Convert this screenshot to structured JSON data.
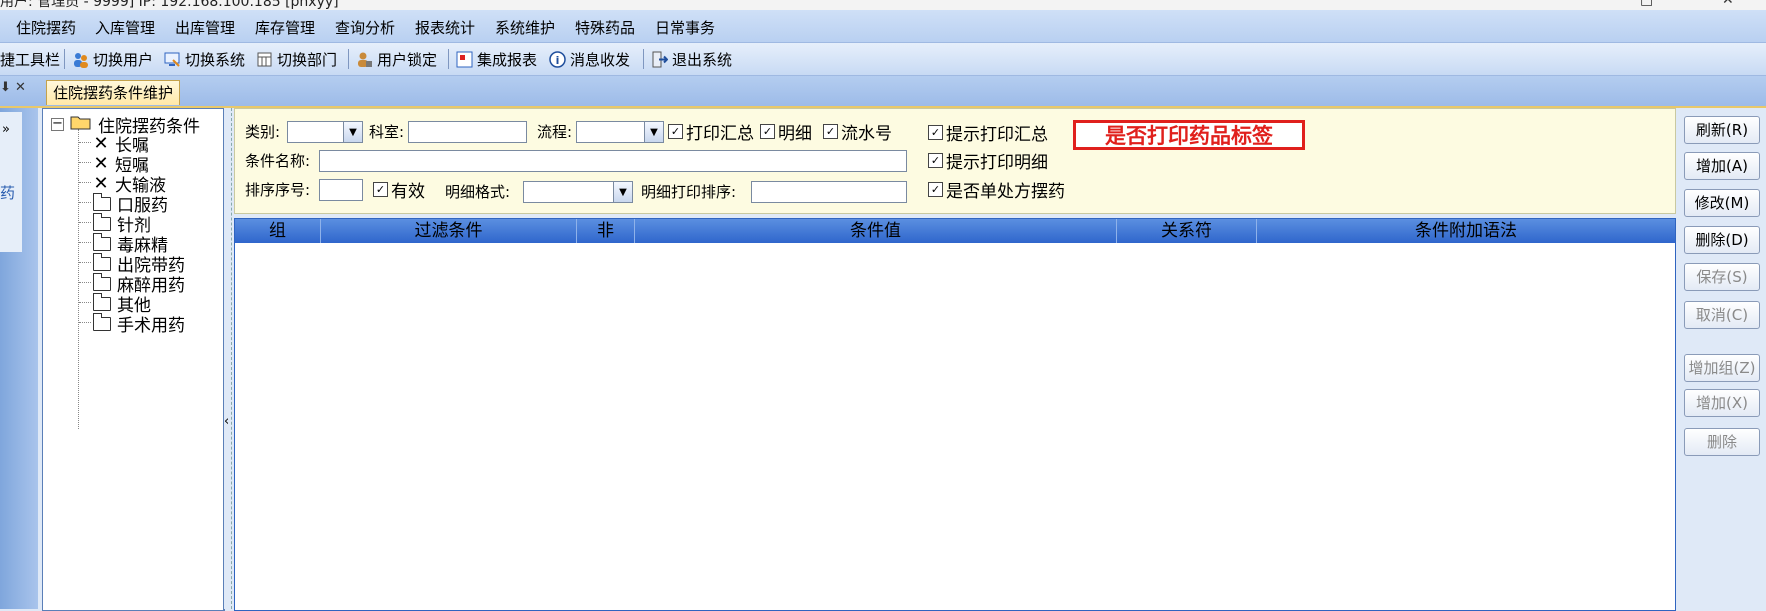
{
  "window": {
    "title": "用户: 管理员 - 9999] IP: 192.168.100.185 [phxyy]",
    "controls": [
      "□",
      "✕"
    ]
  },
  "menubar": {
    "items": [
      "住院摆药",
      "入库管理",
      "出库管理",
      "库存管理",
      "查询分析",
      "报表统计",
      "系统维护",
      "特殊药品",
      "日常事务"
    ]
  },
  "toolbar": {
    "quick_label": "快捷工具栏",
    "items": [
      {
        "label": "切换用户",
        "icon": "switch-user-icon"
      },
      {
        "label": "切换系统",
        "icon": "switch-system-icon"
      },
      {
        "label": "切换部门",
        "icon": "switch-dept-icon"
      },
      {
        "label": "用户锁定",
        "icon": "lock-user-icon"
      },
      {
        "label": "集成报表",
        "icon": "report-icon"
      },
      {
        "label": "消息收发",
        "icon": "info-icon"
      },
      {
        "label": "退出系统",
        "icon": "exit-icon"
      }
    ]
  },
  "tabs": {
    "pin_glyph": "⬇ ✕",
    "active_tab": "住院摆药条件维护"
  },
  "leftnav": {
    "label": "药",
    "collapse_glyph": "»"
  },
  "tree": {
    "root": "住院摆药条件",
    "nodes": [
      {
        "label": "长嘱",
        "type": "x"
      },
      {
        "label": "短嘱",
        "type": "x"
      },
      {
        "label": "大输液",
        "type": "x"
      },
      {
        "label": "口服药",
        "type": "folder"
      },
      {
        "label": "针剂",
        "type": "folder"
      },
      {
        "label": "毒麻精",
        "type": "folder"
      },
      {
        "label": "出院带药",
        "type": "folder"
      },
      {
        "label": "麻醉用药",
        "type": "folder"
      },
      {
        "label": "其他",
        "type": "folder"
      },
      {
        "label": "手术用药",
        "type": "folder"
      }
    ]
  },
  "form": {
    "category_label": "类别:",
    "department_label": "科室:",
    "flow_label": "流程:",
    "print_summary_label": "打印汇总",
    "detail_label": "明细",
    "serial_label": "流水号",
    "condition_name_label": "条件名称:",
    "sort_order_label": "排序序号:",
    "valid_label": "有效",
    "detail_format_label": "明细格式:",
    "detail_print_sort_label": "明细打印排序:",
    "prompt_print_summary_label": "提示打印汇总",
    "prompt_print_detail_label": "提示打印明细",
    "single_prescription_label": "是否单处方摆药",
    "print_drug_label": "是否打印药品标签",
    "checks": {
      "print_summary": true,
      "detail": true,
      "serial": true,
      "valid": true,
      "prompt_summary": true,
      "prompt_detail": true,
      "single_prescription": true
    }
  },
  "grid": {
    "columns": [
      "组",
      "过滤条件",
      "非",
      "条件值",
      "关系符",
      "条件附加语法"
    ],
    "rows": []
  },
  "buttons": {
    "refresh": "刷新(R)",
    "add": "增加(A)",
    "modify": "修改(M)",
    "delete": "删除(D)",
    "save": "保存(S)",
    "cancel": "取消(C)",
    "add_group": "增加组(Z)",
    "add_x": "增加(X)",
    "delete2": "删除"
  },
  "colors": {
    "accent": "#2f66cc",
    "highlight_border": "#e0201c"
  }
}
